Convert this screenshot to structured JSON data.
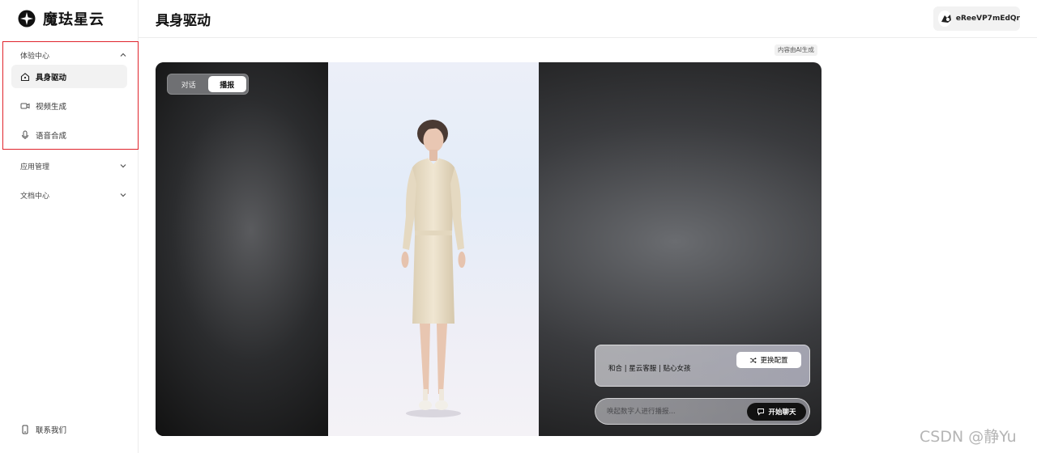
{
  "app": {
    "brand": "魔珐星云"
  },
  "sidebar": {
    "experience": {
      "label": "体验中心",
      "items": [
        {
          "label": "具身驱动",
          "icon": "home-icon",
          "active": true
        },
        {
          "label": "视频生成",
          "icon": "video-icon"
        },
        {
          "label": "语音合成",
          "icon": "microphone-icon"
        }
      ]
    },
    "app_manage": {
      "label": "应用管理"
    },
    "docs": {
      "label": "文档中心"
    },
    "contact": {
      "label": "联系我们"
    }
  },
  "header": {
    "title": "具身驱动",
    "username": "eReeVP7mEdQr"
  },
  "stage": {
    "ai_tag": "内容由AI生成",
    "modes": [
      {
        "label": "对话"
      },
      {
        "label": "播报",
        "active": true
      }
    ],
    "config": {
      "description": "和合 | 星云客服 | 贴心女孩",
      "button": "更换配置"
    },
    "input": {
      "placeholder": "唤起数字人进行播报...",
      "value": ""
    },
    "chat_button": "开始聊天"
  },
  "watermark": "CSDN @静Yu",
  "colors": {
    "highlight_border": "#e0242c",
    "chat_button": "#111111"
  }
}
